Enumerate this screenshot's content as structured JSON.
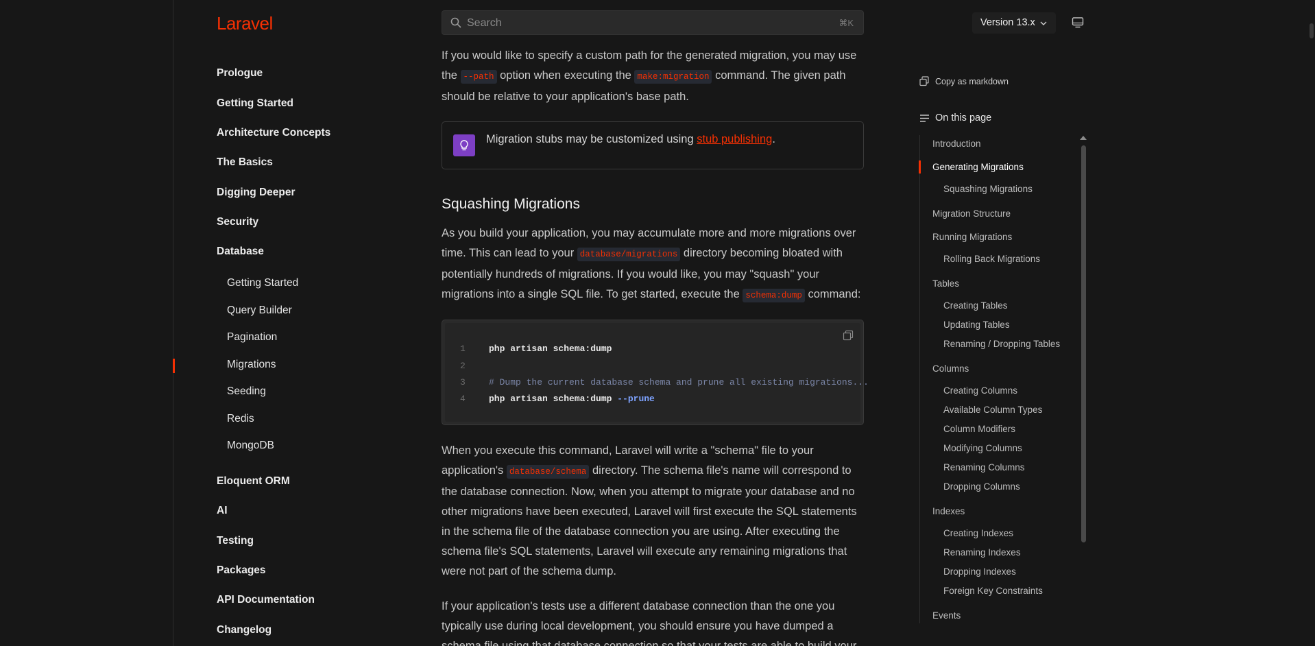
{
  "brand": "Laravel",
  "search": {
    "placeholder": "Search",
    "shortcut": "⌘K"
  },
  "version": {
    "label": "Version 13.x"
  },
  "sidebar": {
    "items": [
      {
        "label": "Prologue"
      },
      {
        "label": "Getting Started"
      },
      {
        "label": "Architecture Concepts"
      },
      {
        "label": "The Basics"
      },
      {
        "label": "Digging Deeper"
      },
      {
        "label": "Security"
      },
      {
        "label": "Database"
      }
    ],
    "database_children": [
      {
        "label": "Getting Started"
      },
      {
        "label": "Query Builder"
      },
      {
        "label": "Pagination"
      },
      {
        "label": "Migrations",
        "active": true
      },
      {
        "label": "Seeding"
      },
      {
        "label": "Redis"
      },
      {
        "label": "MongoDB"
      }
    ],
    "items_after": [
      {
        "label": "Eloquent ORM"
      },
      {
        "label": "AI"
      },
      {
        "label": "Testing"
      },
      {
        "label": "Packages"
      },
      {
        "label": "API Documentation"
      },
      {
        "label": "Changelog"
      }
    ]
  },
  "content": {
    "p1": {
      "t1": "If you would like to specify a custom path for the generated migration, you may use the ",
      "c1": "--path",
      "t2": " option when executing the ",
      "c2": "make:migration",
      "t3": " command. The given path should be relative to your application's base path."
    },
    "callout": {
      "text": "Migration stubs may be customized using ",
      "link": "stub publishing",
      "end": "."
    },
    "heading": "Squashing Migrations",
    "p2": {
      "t1": "As you build your application, you may accumulate more and more migrations over time. This can lead to your ",
      "c1": "database/migrations",
      "t2": " directory becoming bloated with potentially hundreds of migrations. If you would like, you may \"squash\" your migrations into a single SQL file. To get started, execute the ",
      "c2": "schema:dump",
      "t3": " command:"
    },
    "code": {
      "lines": [
        {
          "n": "1",
          "text": "php artisan schema:dump"
        },
        {
          "n": "2",
          "text": ""
        },
        {
          "n": "3",
          "text": "# Dump the current database schema and prune all existing migrations..."
        },
        {
          "n": "4",
          "text": "php artisan schema:dump ",
          "flag": "--prune"
        }
      ]
    },
    "p3": {
      "t1": "When you execute this command, Laravel will write a \"schema\" file to your application's ",
      "c1": "database/schema",
      "t2": " directory. The schema file's name will correspond to the database connection. Now, when you attempt to migrate your database and no other migrations have been executed, Laravel will first execute the SQL statements in the schema file of the database connection you are using. After executing the schema file's SQL statements, Laravel will execute any remaining migrations that were not part of the schema dump."
    },
    "p4": "If your application's tests use a different database connection than the one you typically use during local development, you should ensure you have dumped a schema file using that database connection so that your tests are able to build your"
  },
  "toc": {
    "copy_markdown": "Copy as markdown",
    "title": "On this page",
    "items": [
      {
        "label": "Introduction",
        "level": 1
      },
      {
        "label": "Generating Migrations",
        "level": 1,
        "active": true
      },
      {
        "label": "Squashing Migrations",
        "level": 2
      },
      {
        "label": "Migration Structure",
        "level": 1
      },
      {
        "label": "Running Migrations",
        "level": 1
      },
      {
        "label": "Rolling Back Migrations",
        "level": 2
      },
      {
        "label": "Tables",
        "level": 1
      },
      {
        "label": "Creating Tables",
        "level": 2
      },
      {
        "label": "Updating Tables",
        "level": 2
      },
      {
        "label": "Renaming / Dropping Tables",
        "level": 2
      },
      {
        "label": "Columns",
        "level": 1
      },
      {
        "label": "Creating Columns",
        "level": 2
      },
      {
        "label": "Available Column Types",
        "level": 2
      },
      {
        "label": "Column Modifiers",
        "level": 2
      },
      {
        "label": "Modifying Columns",
        "level": 2
      },
      {
        "label": "Renaming Columns",
        "level": 2
      },
      {
        "label": "Dropping Columns",
        "level": 2
      },
      {
        "label": "Indexes",
        "level": 1
      },
      {
        "label": "Creating Indexes",
        "level": 2
      },
      {
        "label": "Renaming Indexes",
        "level": 2
      },
      {
        "label": "Dropping Indexes",
        "level": 2
      },
      {
        "label": "Foreign Key Constraints",
        "level": 2
      },
      {
        "label": "Events",
        "level": 1
      }
    ]
  },
  "colors": {
    "accent": "#f53003",
    "background": "#171717",
    "callout_badge": "#7d3fc4"
  }
}
